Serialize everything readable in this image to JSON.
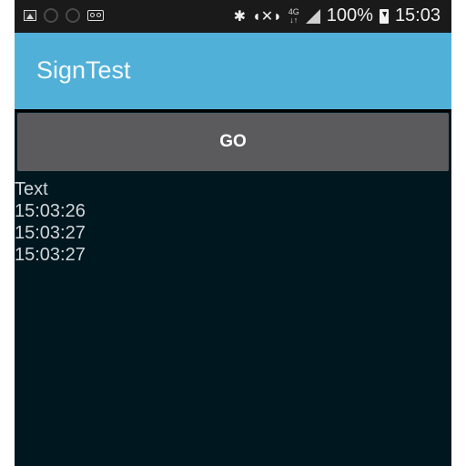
{
  "status_bar": {
    "left_icons": [
      "image-icon",
      "sync-icon",
      "sync-icon",
      "voicemail-icon"
    ],
    "bluetooth_icon": "bluetooth-icon",
    "mute_icon": "vibrate-mute-icon",
    "network_type": "4G",
    "signal_icon": "signal-icon",
    "battery_percent": "100%",
    "battery_icon": "battery-charging-icon",
    "clock": "15:03"
  },
  "app_bar": {
    "title": "SignTest",
    "color": "#51b0d8"
  },
  "main": {
    "go_button_label": "GO",
    "log_lines": [
      "Text",
      "15:03:26",
      "15:03:27",
      "15:03:27"
    ]
  },
  "colors": {
    "background": "#011720",
    "button": "#5b5b5d",
    "text": "#d0d6d8"
  }
}
